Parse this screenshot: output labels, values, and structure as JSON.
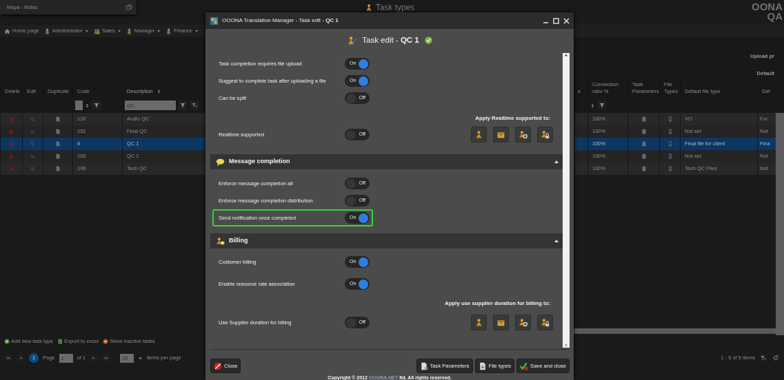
{
  "notes_panel": {
    "title": "Maya - Notes"
  },
  "page_title": "Task types",
  "logo": {
    "line_1": "OONA",
    "line_2": "QA"
  },
  "nav": [
    {
      "label": "Home page",
      "kind": "home",
      "dropdown": false
    },
    {
      "label": "Administrator",
      "kind": "person",
      "dropdown": true
    },
    {
      "label": "Sales",
      "kind": "people",
      "dropdown": true
    },
    {
      "label": "Manager",
      "kind": "person",
      "dropdown": true
    },
    {
      "label": "Finance",
      "kind": "person",
      "dropdown": true
    }
  ],
  "grid": {
    "columns_left": [
      {
        "label": "Delete",
        "sorted": false
      },
      {
        "label": "Edit",
        "sorted": false
      },
      {
        "label": "Duplicate",
        "sorted": false
      },
      {
        "label": "Code",
        "sorted": false
      },
      {
        "label": "Description",
        "sorted": true
      }
    ],
    "description_filter": {
      "value": "QC"
    },
    "group_headers": [
      "Upload pr",
      "Default"
    ],
    "columns_right": [
      {
        "label": "e"
      },
      {
        "label": "Conversion ratio %"
      },
      {
        "label": "Task Parameters"
      },
      {
        "label": "File Types"
      },
      {
        "label": "Default file type"
      },
      {
        "label": "Def"
      }
    ],
    "rows": [
      {
        "code": "120",
        "description": "Audio QC",
        "conversion": "100%",
        "default_file_type": "VO",
        "column_def": "For",
        "selected": false
      },
      {
        "code": "152",
        "description": "Final QC",
        "conversion": "100%",
        "default_file_type": "Not set",
        "column_def": "Not",
        "selected": false
      },
      {
        "code": "4",
        "description": "QC 1",
        "conversion": "100%",
        "default_file_type": "Final file for client",
        "column_def": "Fina",
        "selected": true
      },
      {
        "code": "205",
        "description": "QC 2",
        "conversion": "100%",
        "default_file_type": "Not set",
        "column_def": "Not",
        "selected": false
      },
      {
        "code": "196",
        "description": "Tech QC",
        "conversion": "100%",
        "default_file_type": "Tech QC Files",
        "column_def": "Not",
        "selected": false
      }
    ]
  },
  "footer_actions": [
    {
      "label": "Add new task type",
      "kind": "add"
    },
    {
      "label": "Export to excel",
      "kind": "export"
    },
    {
      "label": "Show inactive tasks",
      "kind": "inactive"
    }
  ],
  "pager": {
    "current": "1",
    "page_label": "Page",
    "page_value": "1",
    "of": "of 1",
    "page_size": "20",
    "per_page": "items per page",
    "summary": "1 - 5 of 5 items"
  },
  "dialog": {
    "window_title": "OOONA Translation Manager - Task edit - **QC 1**",
    "heading": "Task edit - **QC 1**",
    "settings": [
      {
        "kind": "toggle",
        "label": "Task completion requires file upload",
        "on": true,
        "text": "On",
        "highlighted": false
      },
      {
        "kind": "toggle",
        "label": "Suggest to complete task after uploading a file",
        "on": true,
        "text": "On",
        "highlighted": false
      },
      {
        "kind": "toggle",
        "label": "Can be split",
        "on": false,
        "text": "Off",
        "highlighted": false
      },
      {
        "kind": "caption",
        "label": "Apply Realtime supported to:"
      },
      {
        "kind": "toggle",
        "label": "Realtime supported",
        "on": false,
        "text": "Off",
        "highlighted": false,
        "targets": true
      }
    ],
    "sections": [
      {
        "title": "Message completion",
        "kind": "message",
        "expanded": true,
        "items": [
          {
            "kind": "toggle",
            "label": "Enforce message completion all",
            "on": false,
            "text": "Off",
            "highlighted": false
          },
          {
            "kind": "toggle",
            "label": "Enforce message completion distribution",
            "on": false,
            "text": "Off",
            "highlighted": false
          },
          {
            "kind": "toggle",
            "label": "Send notification once completed",
            "on": true,
            "text": "On",
            "highlighted": true
          }
        ]
      },
      {
        "title": "Billing",
        "kind": "billing",
        "expanded": true,
        "items": [
          {
            "kind": "toggle",
            "label": "Customer billing",
            "on": true,
            "text": "On",
            "highlighted": false
          },
          {
            "kind": "toggle",
            "label": "Enable resource rate association",
            "on": true,
            "text": "On",
            "highlighted": false
          },
          {
            "kind": "caption",
            "label": "Apply use supplier duration for billing to:"
          },
          {
            "kind": "toggle",
            "label": "Use Supplier duration for billing",
            "on": false,
            "text": "Off",
            "highlighted": false,
            "targets": true
          }
        ]
      }
    ],
    "buttons": [
      {
        "label": "Close",
        "kind": "close"
      },
      {
        "label": "Task Parameters",
        "kind": "params"
      },
      {
        "label": "File types",
        "kind": "files"
      },
      {
        "label": "Save and close",
        "kind": "save"
      }
    ],
    "copyright": {
      "before": "Copyright © 2012 ",
      "brand": "OOONA.NET",
      "after": " ltd. All rights reserved."
    }
  }
}
